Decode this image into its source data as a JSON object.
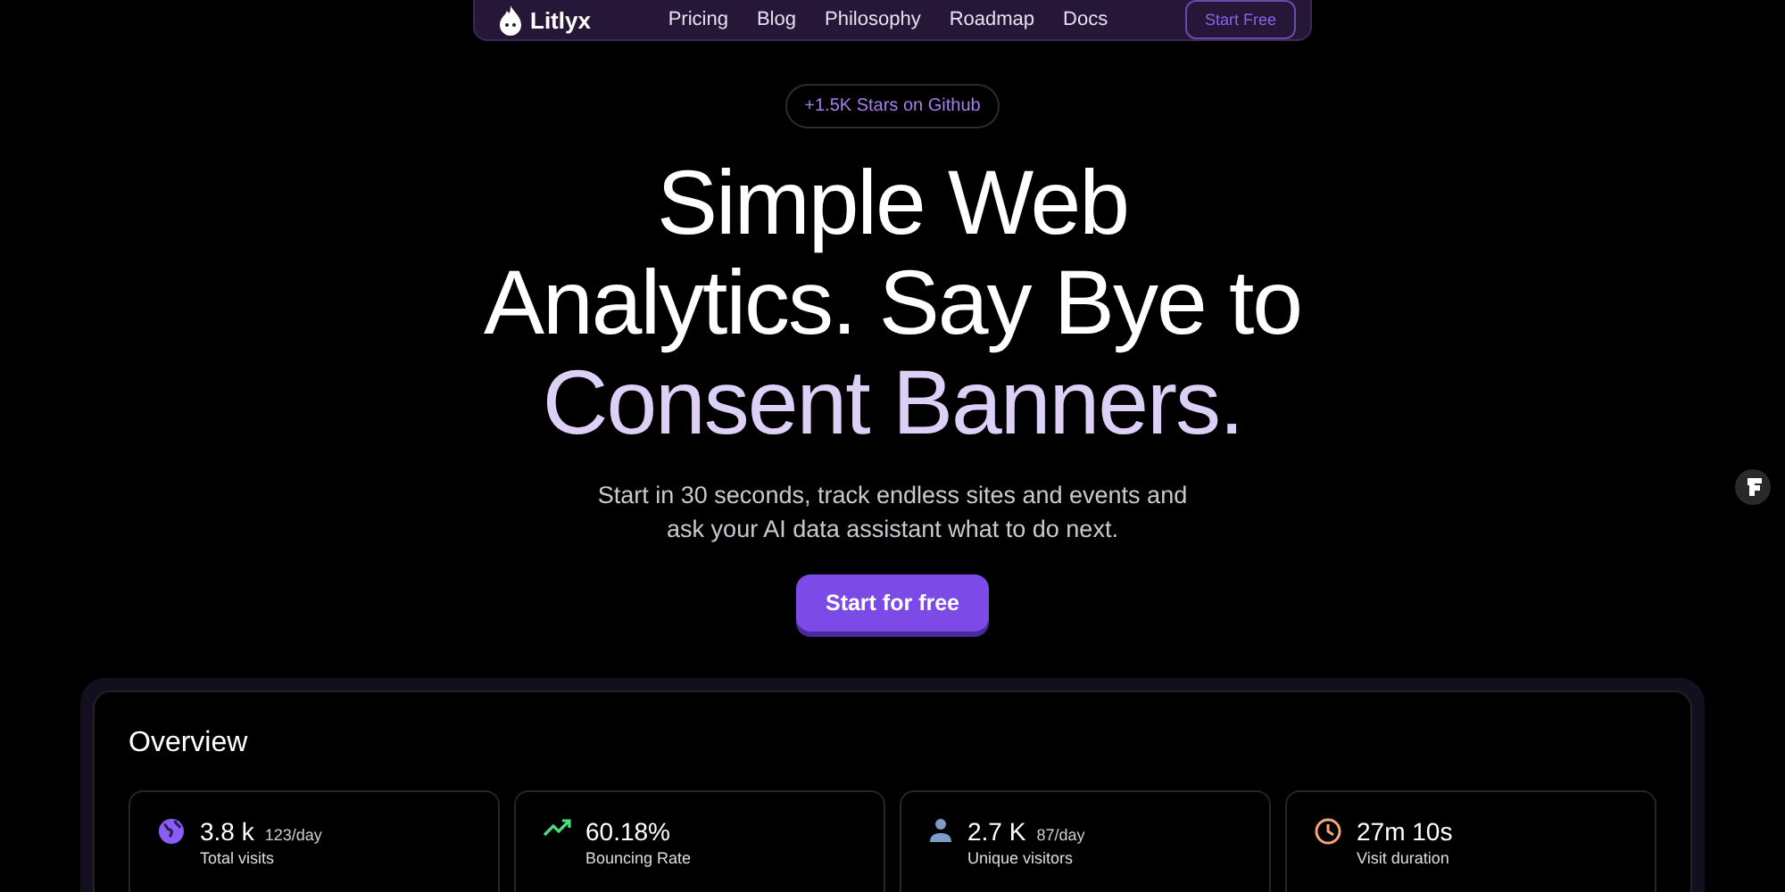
{
  "nav": {
    "brand": "Litlyx",
    "links": [
      "Pricing",
      "Blog",
      "Philosophy",
      "Roadmap",
      "Docs"
    ],
    "cta": "Start Free"
  },
  "badge": "+1.5K Stars on Github",
  "headline": [
    {
      "text": "Simple Web",
      "highlight": false
    },
    {
      "text": "Analytics. Say Bye to",
      "highlight": false
    },
    {
      "text": "Consent Banners.",
      "highlight": true
    }
  ],
  "subtitle": "Start in 30 seconds, track endless sites and events and ask your AI data assistant what to do next.",
  "primary_button": "Start for free",
  "dashboard": {
    "title": "Overview",
    "stats": [
      {
        "kind": "globe",
        "value": "3.8 k",
        "rate": "123/day",
        "label": "Total visits"
      },
      {
        "kind": "trend",
        "value": "60.18%",
        "label": "Bouncing Rate"
      },
      {
        "kind": "person",
        "value": "2.7 K",
        "rate": "87/day",
        "label": "Unique visitors"
      },
      {
        "kind": "clock",
        "value": "27m 10s",
        "label": "Visit duration"
      }
    ]
  }
}
